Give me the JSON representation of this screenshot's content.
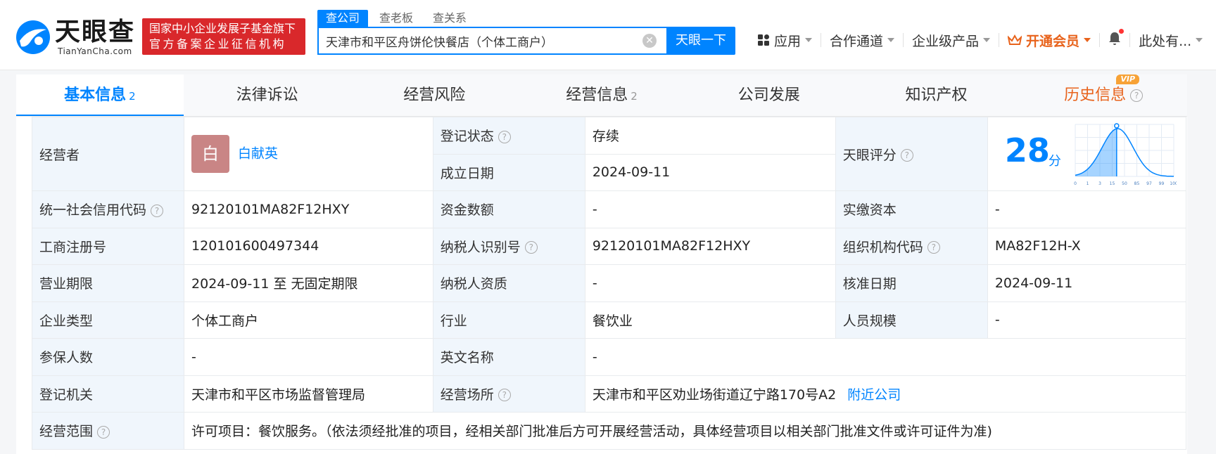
{
  "brand": {
    "logo_text": "天眼查",
    "logo_sub": "TianYanCha.com",
    "badge_line1": "国家中小企业发展子基金旗下",
    "badge_line2": "官方备案企业征信机构"
  },
  "search": {
    "tabs": [
      "查公司",
      "查老板",
      "查关系"
    ],
    "value": "天津市和平区舟饼伦快餐店（个体工商户）",
    "button": "天眼一下"
  },
  "nav": {
    "app": "应用",
    "partner": "合作通道",
    "enterprise": "企业级产品",
    "vip": "开通会员",
    "user": "此处有..."
  },
  "tabs": [
    {
      "label": "基本信息",
      "count": "2"
    },
    {
      "label": "法律诉讼",
      "count": ""
    },
    {
      "label": "经营风险",
      "count": ""
    },
    {
      "label": "经营信息",
      "count": "2"
    },
    {
      "label": "公司发展",
      "count": ""
    },
    {
      "label": "知识产权",
      "count": ""
    },
    {
      "label": "历史信息",
      "count": "",
      "tag": "VIP"
    }
  ],
  "info": {
    "operator_label": "经营者",
    "operator_avatar": "白",
    "operator_name": "白献英",
    "status_label": "登记状态",
    "status_value": "存续",
    "founded_label": "成立日期",
    "founded_value": "2024-09-11",
    "score_label": "天眼评分",
    "score_value": "28",
    "score_unit": "分",
    "credit_code_label": "统一社会信用代码",
    "credit_code_value": "92120101MA82F12HXY",
    "capital_label": "资金数额",
    "capital_value": "-",
    "paid_label": "实缴资本",
    "paid_value": "-",
    "reg_no_label": "工商注册号",
    "reg_no_value": "120101600497344",
    "taxpayer_id_label": "纳税人识别号",
    "taxpayer_id_value": "92120101MA82F12HXY",
    "org_code_label": "组织机构代码",
    "org_code_value": "MA82F12H-X",
    "term_label": "营业期限",
    "term_value": "2024-09-11 至 无固定期限",
    "tax_qual_label": "纳税人资质",
    "tax_qual_value": "-",
    "approve_label": "核准日期",
    "approve_value": "2024-09-11",
    "type_label": "企业类型",
    "type_value": "个体工商户",
    "industry_label": "行业",
    "industry_value": "餐饮业",
    "staff_label": "人员规模",
    "staff_value": "-",
    "insured_label": "参保人数",
    "insured_value": "-",
    "en_name_label": "英文名称",
    "en_name_value": "-",
    "authority_label": "登记机关",
    "authority_value": "天津市和平区市场监督管理局",
    "address_label": "经营场所",
    "address_value": "天津市和平区劝业场街道辽宁路170号A2",
    "nearby_link": "附近公司",
    "scope_label": "经营范围",
    "scope_value": "许可项目：餐饮服务。（依法须经批准的项目，经相关部门批准后方可开展经营活动，具体经营项目以相关部门批准文件或许可证件为准)"
  },
  "score_chart": {
    "ticks": [
      "0",
      "1",
      "3",
      "15",
      "50",
      "85",
      "97",
      "99",
      "100"
    ],
    "accent": "#0084ff"
  }
}
